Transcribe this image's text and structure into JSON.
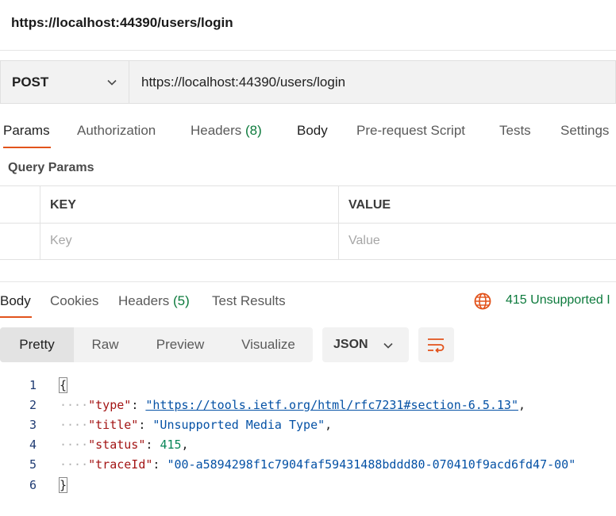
{
  "request": {
    "title": "https://localhost:44390/users/login",
    "method": "POST",
    "url": "https://localhost:44390/users/login"
  },
  "request_tabs": {
    "params": "Params",
    "authorization": "Authorization",
    "headers": "Headers",
    "headers_count": "(8)",
    "body": "Body",
    "prerequest": "Pre-request Script",
    "tests": "Tests",
    "settings": "Settings"
  },
  "query_params": {
    "label": "Query Params",
    "key_header": "KEY",
    "value_header": "VALUE",
    "key_placeholder": "Key",
    "value_placeholder": "Value"
  },
  "response_tabs": {
    "body": "Body",
    "cookies": "Cookies",
    "headers": "Headers",
    "headers_count": "(5)",
    "test_results": "Test Results"
  },
  "response_status": {
    "text": "415 Unsupported I",
    "color": "#0c7a3c"
  },
  "view_modes": {
    "pretty": "Pretty",
    "raw": "Raw",
    "preview": "Preview",
    "visualize": "Visualize"
  },
  "format": "JSON",
  "icons": {
    "method_dropdown": "chevron-down-icon",
    "status": "globe-network-icon",
    "format_dropdown": "chevron-down-icon",
    "wrap": "text-wrap-icon"
  },
  "accent_color": "#e2531c",
  "response_body": {
    "line_numbers": [
      "1",
      "2",
      "3",
      "4",
      "5",
      "6"
    ],
    "open_brace": "{",
    "close_brace": "}",
    "fields": [
      {
        "key": "\"type\"",
        "value": "\"https://tools.ietf.org/html/rfc7231#section-6.5.13\"",
        "trail": ","
      },
      {
        "key": "\"title\"",
        "value": "\"Unsupported Media Type\"",
        "trail": ","
      },
      {
        "key": "\"status\"",
        "value": "415",
        "trail": ","
      },
      {
        "key": "\"traceId\"",
        "value": "\"00-a5894298f1c7904faf59431488bddd80-070410f9acd6fd47-00\"",
        "trail": ""
      }
    ]
  }
}
